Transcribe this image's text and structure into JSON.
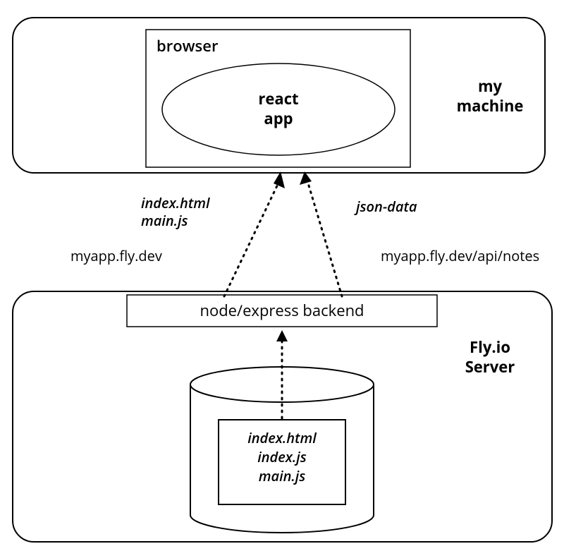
{
  "diagram": {
    "topBox": {
      "sideLabel1": "my",
      "sideLabel2": "machine",
      "innerBoxLabel": "browser",
      "ellipseLabel1": "react",
      "ellipseLabel2": "app"
    },
    "middle": {
      "leftArrowLabel1": "index.html",
      "leftArrowLabel2": "main.js",
      "leftUrl": "myapp.fly.dev",
      "rightArrowLabel": "json-data",
      "rightUrl": "myapp.fly.dev/api/notes"
    },
    "bottomBox": {
      "sideLabel1": "Fly.io",
      "sideLabel2": "Server",
      "backendLabel": "node/express backend",
      "cylinderFiles": {
        "file1": "index.html",
        "file2": "index.js",
        "file3": "main.js"
      }
    }
  }
}
